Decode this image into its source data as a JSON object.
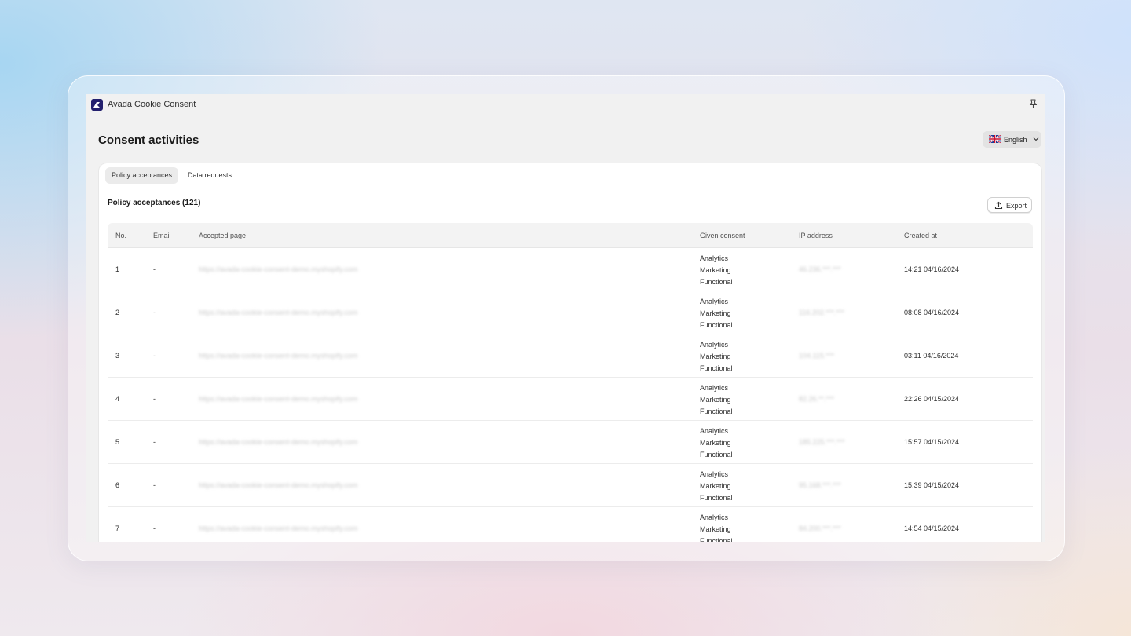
{
  "app": {
    "name": "Avada Cookie Consent"
  },
  "page": {
    "title": "Consent activities"
  },
  "language": {
    "selected": "English",
    "flag_icon": "uk-flag-icon"
  },
  "tabs": [
    {
      "label": "Policy acceptances",
      "active": true
    },
    {
      "label": "Data requests",
      "active": false
    }
  ],
  "section": {
    "title": "Policy acceptances (121)",
    "export_label": "Export"
  },
  "table": {
    "columns": [
      "No.",
      "Email",
      "Accepted page",
      "Given consent",
      "IP address",
      "Created at"
    ],
    "rows": [
      {
        "no": "1",
        "email": "-",
        "page": "https://avada-cookie-consent-demo.myshopify.com",
        "consent": [
          "Analytics",
          "Marketing",
          "Functional"
        ],
        "ip": "46.236.***.***",
        "created": "14:21 04/16/2024"
      },
      {
        "no": "2",
        "email": "-",
        "page": "https://avada-cookie-consent-demo.myshopify.com",
        "consent": [
          "Analytics",
          "Marketing",
          "Functional"
        ],
        "ip": "116.202.***.***",
        "created": "08:08 04/16/2024"
      },
      {
        "no": "3",
        "email": "-",
        "page": "https://avada-cookie-consent-demo.myshopify.com",
        "consent": [
          "Analytics",
          "Marketing",
          "Functional"
        ],
        "ip": "104.115.***",
        "created": "03:11 04/16/2024"
      },
      {
        "no": "4",
        "email": "-",
        "page": "https://avada-cookie-consent-demo.myshopify.com",
        "consent": [
          "Analytics",
          "Marketing",
          "Functional"
        ],
        "ip": "82.26.**.***",
        "created": "22:26 04/15/2024"
      },
      {
        "no": "5",
        "email": "-",
        "page": "https://avada-cookie-consent-demo.myshopify.com",
        "consent": [
          "Analytics",
          "Marketing",
          "Functional"
        ],
        "ip": "185.225.***.***",
        "created": "15:57 04/15/2024"
      },
      {
        "no": "6",
        "email": "-",
        "page": "https://avada-cookie-consent-demo.myshopify.com",
        "consent": [
          "Analytics",
          "Marketing",
          "Functional"
        ],
        "ip": "95.168.***.***",
        "created": "15:39 04/15/2024"
      },
      {
        "no": "7",
        "email": "-",
        "page": "https://avada-cookie-consent-demo.myshopify.com",
        "consent": [
          "Analytics",
          "Marketing",
          "Functional"
        ],
        "ip": "84.200.***.***",
        "created": "14:54 04/15/2024"
      }
    ]
  }
}
